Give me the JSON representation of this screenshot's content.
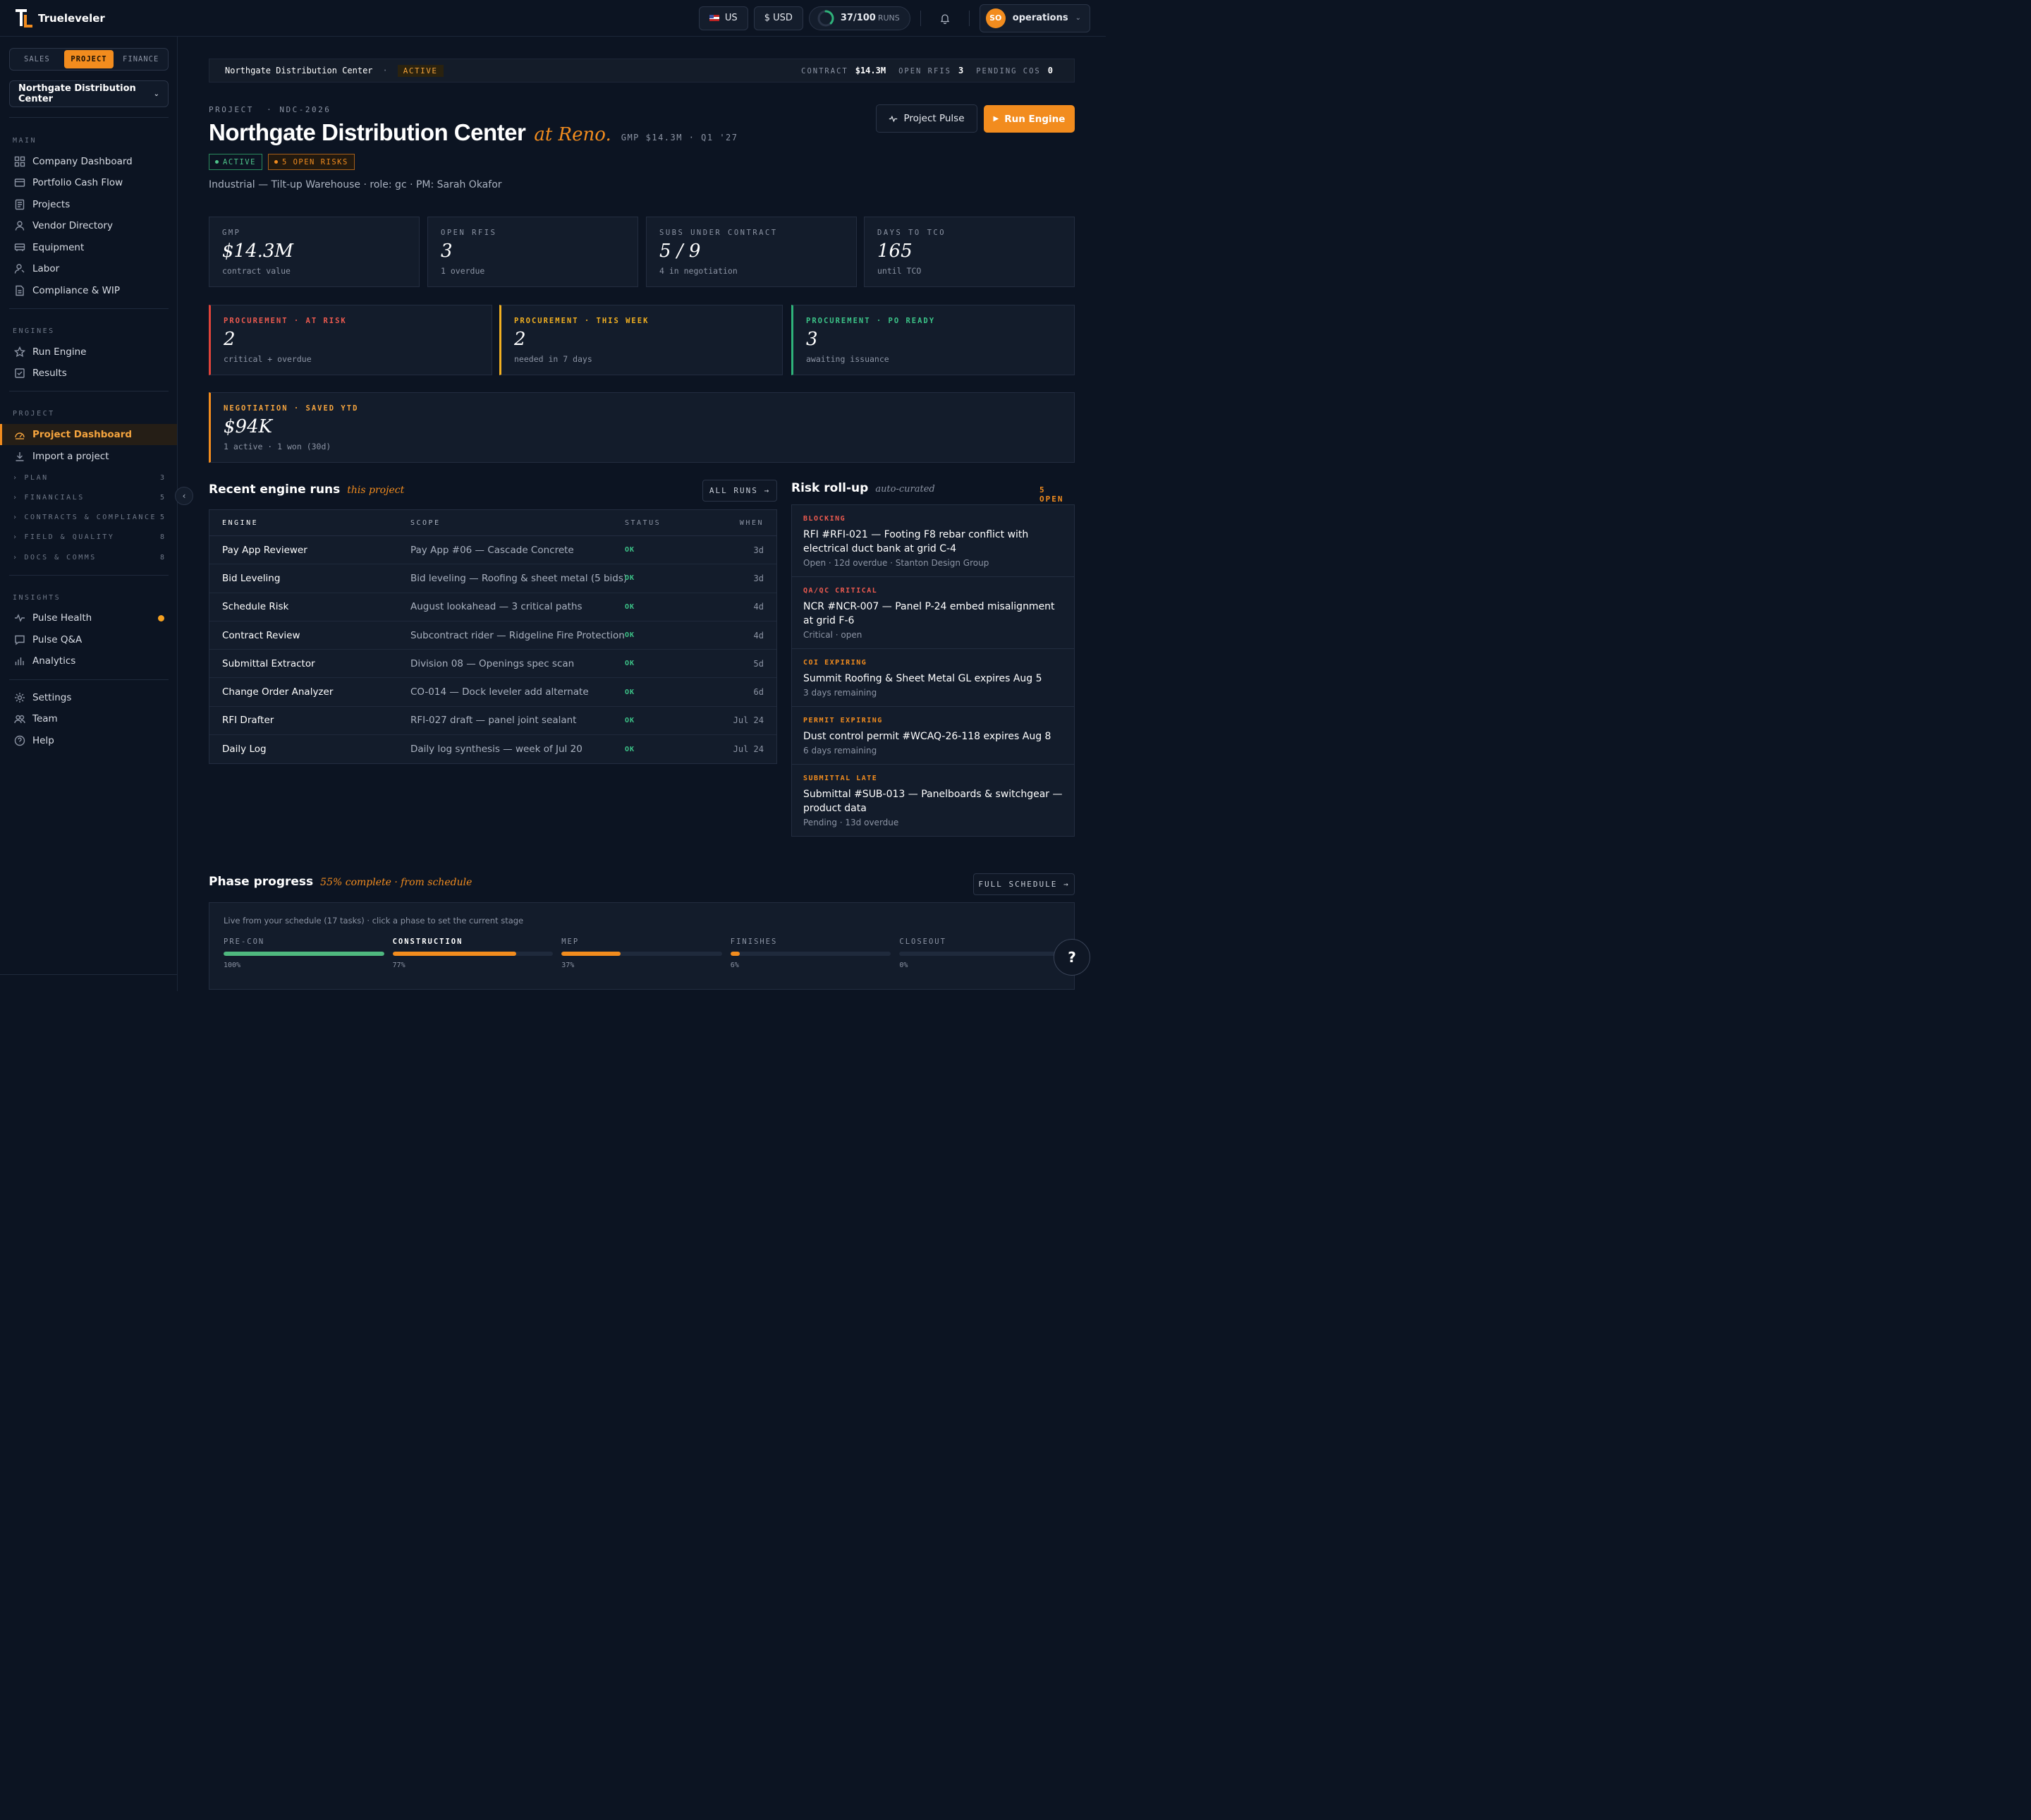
{
  "app": {
    "name": "Trueleveler"
  },
  "topbar": {
    "region": "US",
    "currency": "$ USD",
    "runs_used": "37/100",
    "runs_label": "RUNS",
    "runs_fraction": 0.37,
    "user_initials": "SO",
    "user_name": "operations"
  },
  "sidebar": {
    "segments": [
      "SALES",
      "PROJECT",
      "FINANCE"
    ],
    "active_segment": "PROJECT",
    "project_select": "Northgate Distribution Center",
    "sections": {
      "main": "MAIN",
      "engines": "ENGINES",
      "project": "PROJECT",
      "insights": "INSIGHTS"
    },
    "main_items": [
      "Company Dashboard",
      "Portfolio Cash Flow",
      "Projects",
      "Vendor Directory",
      "Equipment",
      "Labor",
      "Compliance & WIP"
    ],
    "engine_items": [
      "Run Engine",
      "Results"
    ],
    "project_items": [
      "Project Dashboard",
      "Import a project"
    ],
    "groups": [
      {
        "label": "PLAN",
        "count": "3"
      },
      {
        "label": "FINANCIALS",
        "count": "5"
      },
      {
        "label": "CONTRACTS & COMPLIANCE",
        "count": "5"
      },
      {
        "label": "FIELD & QUALITY",
        "count": "8"
      },
      {
        "label": "DOCS & COMMS",
        "count": "8"
      }
    ],
    "insight_items": [
      "Pulse Health",
      "Pulse Q&A",
      "Analytics"
    ],
    "footer_items": [
      "Settings",
      "Team",
      "Help"
    ]
  },
  "context_bar": {
    "name": "Northgate Distribution Center",
    "status": "ACTIVE",
    "contract_label": "CONTRACT",
    "contract_value": "$14.3M",
    "rfis_label": "OPEN RFIS",
    "rfis_value": "3",
    "cos_label": "PENDING COS",
    "cos_value": "0"
  },
  "header": {
    "eyebrow": "PROJECT  · NDC-2026",
    "title": "Northgate Distribution Center",
    "location": "at Reno.",
    "meta": "GMP $14.3M · Q1 '27",
    "badge_active": "ACTIVE",
    "badge_risks": "5 OPEN RISKS",
    "subline": "Industrial — Tilt-up Warehouse · role: gc · PM: Sarah Okafor",
    "btn_pulse": "Project Pulse",
    "btn_run": "Run Engine"
  },
  "kpis": [
    {
      "label": "GMP",
      "value": "$14.3M",
      "sub": "contract value"
    },
    {
      "label": "OPEN RFIS",
      "value": "3",
      "sub": "1 overdue"
    },
    {
      "label": "SUBS UNDER CONTRACT",
      "value": "5 / 9",
      "sub": "4 in negotiation"
    },
    {
      "label": "DAYS TO TCO",
      "value": "165",
      "sub": "until TCO"
    }
  ],
  "procurement": [
    {
      "label": "PROCUREMENT · AT RISK",
      "value": "2",
      "sub": "critical + overdue"
    },
    {
      "label": "PROCUREMENT · THIS WEEK",
      "value": "2",
      "sub": "needed in 7 days"
    },
    {
      "label": "PROCUREMENT · PO READY",
      "value": "3",
      "sub": "awaiting issuance"
    }
  ],
  "negotiation": {
    "label": "NEGOTIATION · SAVED YTD",
    "value": "$94K",
    "sub": "1 active · 1 won (30d)"
  },
  "runs": {
    "title": "Recent engine runs",
    "accent": "this project",
    "all_btn": "ALL RUNS →",
    "headers": {
      "engine": "ENGINE",
      "scope": "SCOPE",
      "status": "STATUS",
      "when": "WHEN"
    },
    "rows": [
      {
        "engine": "Pay App Reviewer",
        "scope": "Pay App #06 — Cascade Concrete",
        "status": "OK",
        "when": "3d"
      },
      {
        "engine": "Bid Leveling",
        "scope": "Bid leveling — Roofing & sheet metal (5 bids)",
        "status": "OK",
        "when": "3d"
      },
      {
        "engine": "Schedule Risk",
        "scope": "August lookahead — 3 critical paths",
        "status": "OK",
        "when": "4d"
      },
      {
        "engine": "Contract Review",
        "scope": "Subcontract rider — Ridgeline Fire Protection",
        "status": "OK",
        "when": "4d"
      },
      {
        "engine": "Submittal Extractor",
        "scope": "Division 08 — Openings spec scan",
        "status": "OK",
        "when": "5d"
      },
      {
        "engine": "Change Order Analyzer",
        "scope": "CO-014 — Dock leveler add alternate",
        "status": "OK",
        "when": "6d"
      },
      {
        "engine": "RFI Drafter",
        "scope": "RFI-027 draft — panel joint sealant",
        "status": "OK",
        "when": "Jul 24"
      },
      {
        "engine": "Daily Log",
        "scope": "Daily log synthesis — week of Jul 20",
        "status": "OK",
        "when": "Jul 24"
      }
    ]
  },
  "risk": {
    "title": "Risk roll-up",
    "grey": "auto-curated",
    "open": "5 OPEN",
    "items": [
      {
        "kind": "BLOCKING",
        "text": "RFI #RFI-021 — Footing F8 rebar conflict with electrical duct bank at grid C-4",
        "sub": "Open · 12d overdue · Stanton Design Group",
        "color": "#ec5a4f"
      },
      {
        "kind": "QA/QC CRITICAL",
        "text": "NCR #NCR-007 — Panel P-24 embed misalignment at grid F-6",
        "sub": "Critical · open",
        "color": "#ec5a4f"
      },
      {
        "kind": "COI EXPIRING",
        "text": "Summit Roofing & Sheet Metal GL expires Aug 5",
        "sub": "3 days remaining",
        "color": "#f28c1e"
      },
      {
        "kind": "PERMIT EXPIRING",
        "text": "Dust control permit #WCAQ-26-118 expires Aug 8",
        "sub": "6 days remaining",
        "color": "#f28c1e"
      },
      {
        "kind": "SUBMITTAL LATE",
        "text": "Submittal #SUB-013 — Panelboards & switchgear — product data",
        "sub": "Pending · 13d overdue",
        "color": "#f28c1e"
      }
    ]
  },
  "phase": {
    "title": "Phase progress",
    "accent": "55% complete · from schedule",
    "btn": "FULL SCHEDULE →",
    "note": "Live from your schedule (17 tasks) · click a phase to set the current stage",
    "phases": [
      {
        "name": "PRE-CON",
        "pct_label": "100%",
        "pct": 100,
        "color": "#4fb87f",
        "current": false
      },
      {
        "name": "CONSTRUCTION",
        "pct_label": "77%",
        "pct": 77,
        "color": "#f28c1e",
        "current": true
      },
      {
        "name": "MEP",
        "pct_label": "37%",
        "pct": 37,
        "color": "#f28c1e",
        "current": false
      },
      {
        "name": "FINISHES",
        "pct_label": "6%",
        "pct": 6,
        "color": "#f28c1e",
        "current": false
      },
      {
        "name": "CLOSEOUT",
        "pct_label": "0%",
        "pct": 0,
        "color": "#f28c1e",
        "current": false
      }
    ]
  },
  "help_fab": "?"
}
